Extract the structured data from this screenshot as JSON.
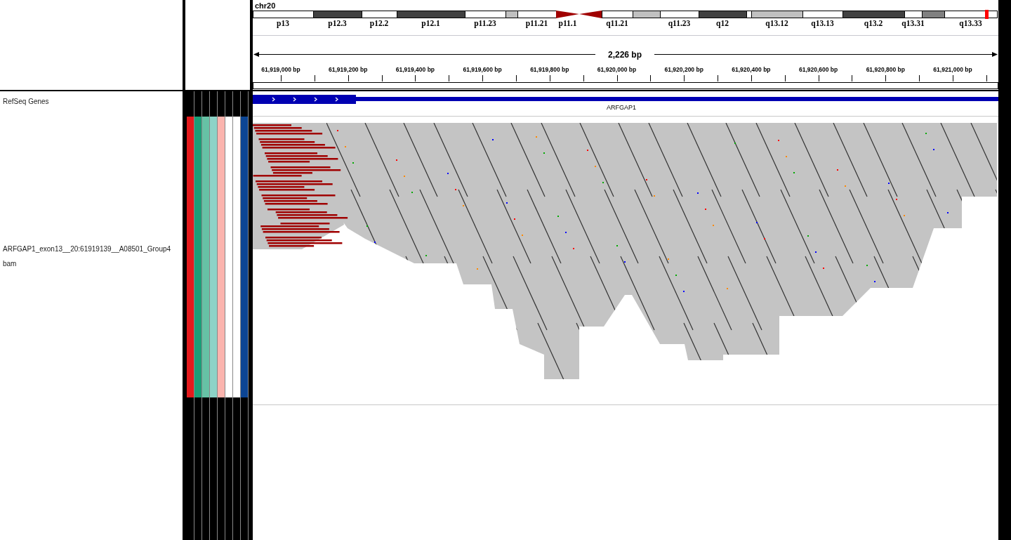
{
  "header": {
    "chromosome": "chr20",
    "bands": [
      {
        "label": "p13",
        "kind": "band",
        "color": "#ffffff"
      },
      {
        "label": "p12.3",
        "kind": "band",
        "color": "#404040"
      },
      {
        "label": "p12.2",
        "kind": "band",
        "color": "#ffffff"
      },
      {
        "label": "p12.1",
        "kind": "band",
        "color": "#404040"
      },
      {
        "label": "p11.23",
        "kind": "band",
        "color": "#ffffff"
      },
      {
        "kind": "band",
        "color": "#c0c0c0"
      },
      {
        "label": "p11.21",
        "kind": "band",
        "color": "#ffffff"
      },
      {
        "label": "p11.1",
        "kind": "centromere",
        "color": "#a00000"
      },
      {
        "kind": "centromere",
        "color": "#a00000"
      },
      {
        "label": "q11.21",
        "kind": "band",
        "color": "#ffffff"
      },
      {
        "kind": "band",
        "color": "#c0c0c0"
      },
      {
        "label": "q11.23",
        "kind": "band",
        "color": "#ffffff"
      },
      {
        "label": "q12",
        "kind": "band",
        "color": "#404040"
      },
      {
        "kind": "band",
        "color": "#ffffff"
      },
      {
        "label": "q13.12",
        "kind": "band",
        "color": "#c0c0c0"
      },
      {
        "label": "q13.13",
        "kind": "band",
        "color": "#ffffff"
      },
      {
        "label": "q13.2",
        "kind": "band",
        "color": "#404040"
      },
      {
        "label": "q13.31",
        "kind": "band",
        "color": "#ffffff"
      },
      {
        "kind": "band",
        "color": "#808080"
      },
      {
        "label": "q13.33",
        "kind": "band",
        "color": "#ffffff"
      }
    ],
    "span": "2,226 bp",
    "ruler_labels": [
      "61,919,000 bp",
      "61,919,200 bp",
      "61,919,400 bp",
      "61,919,600 bp",
      "61,919,800 bp",
      "61,920,000 bp",
      "61,920,200 bp",
      "61,920,400 bp",
      "61,920,600 bp",
      "61,920,800 bp",
      "61,921,000 bp"
    ]
  },
  "tracks": [
    {
      "kind": "gene",
      "name": "RefSeq Genes",
      "gene": "ARFGAP1"
    },
    {
      "kind": "alignment",
      "name_lines": [
        "ARFGAP1_exon13__20:61919139__A08501_Group4",
        "bam"
      ],
      "attributes": [
        {
          "color": "#e41a1c"
        },
        {
          "color": "#1b9e77"
        },
        {
          "color": "#66c2a5"
        },
        {
          "color": "#8dd3c7"
        },
        {
          "color": "#fbb4ae"
        },
        {
          "color": "#ffffff"
        },
        {
          "color": "#ffffff"
        },
        {
          "color": "#0c4594"
        }
      ]
    }
  ]
}
